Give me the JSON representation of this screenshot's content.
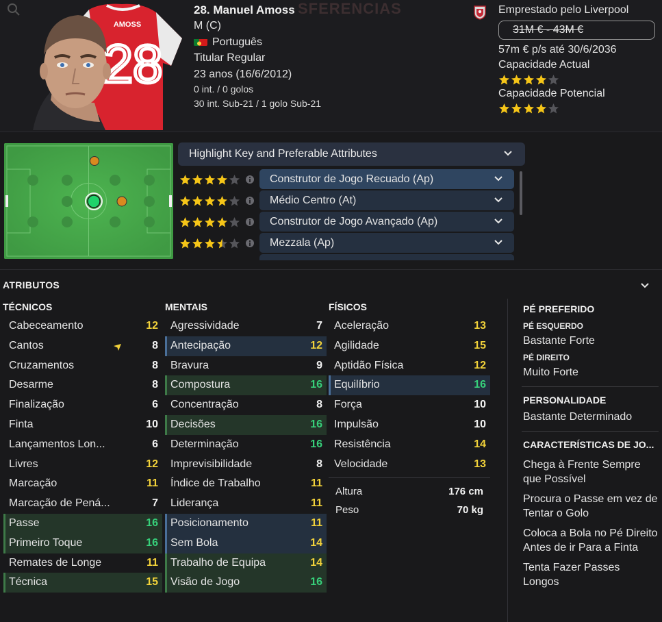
{
  "player": {
    "name": "28. Manuel Amoss",
    "position": "M (C)",
    "nationality": "Português",
    "status": "Titular Regular",
    "age": "23 anos (16/6/2012)",
    "caps": "0 int. / 0 golos",
    "u21_caps": "30 int. Sub-21 / 1 golo Sub-21",
    "shirt_name": "AMOSS",
    "shirt_number": "28"
  },
  "contract": {
    "loan": "Emprestado pelo Liverpool",
    "value_range": "31M € - 43M €",
    "wage": "57m € p/s até 30/6/2036",
    "current_ability_label": "Capacidade Actual",
    "current_ability_stars": 4,
    "potential_ability_label": "Capacidade Potencial",
    "potential_ability_stars": 4
  },
  "roles": {
    "header": "Highlight Key and Preferable Attributes",
    "items": [
      {
        "label": "Construtor de Jogo Recuado (Ap)",
        "stars": 4,
        "selected": true
      },
      {
        "label": "Médio Centro (At)",
        "stars": 4,
        "selected": false
      },
      {
        "label": "Construtor de Jogo Avançado (Ap)",
        "stars": 4,
        "selected": false
      },
      {
        "label": "Mezzala (Ap)",
        "stars": 3.5,
        "selected": false
      }
    ]
  },
  "attributes": {
    "title": "ATRIBUTOS",
    "technical": {
      "title": "TÉCNICOS",
      "items": [
        {
          "label": "Cabeceamento",
          "value": "12",
          "color": "yellow",
          "hl": ""
        },
        {
          "label": "Cantos",
          "value": "8",
          "color": "white",
          "hl": ""
        },
        {
          "label": "Cruzamentos",
          "value": "8",
          "color": "white",
          "hl": ""
        },
        {
          "label": "Desarme",
          "value": "8",
          "color": "white",
          "hl": ""
        },
        {
          "label": "Finalização",
          "value": "6",
          "color": "white",
          "hl": ""
        },
        {
          "label": "Finta",
          "value": "10",
          "color": "white",
          "hl": ""
        },
        {
          "label": "Lançamentos Lon...",
          "value": "6",
          "color": "white",
          "hl": ""
        },
        {
          "label": "Livres",
          "value": "12",
          "color": "yellow",
          "hl": ""
        },
        {
          "label": "Marcação",
          "value": "11",
          "color": "yellow",
          "hl": ""
        },
        {
          "label": "Marcação de Pená...",
          "value": "7",
          "color": "white",
          "hl": ""
        },
        {
          "label": "Passe",
          "value": "16",
          "color": "green",
          "hl": "g"
        },
        {
          "label": "Primeiro Toque",
          "value": "16",
          "color": "green",
          "hl": "g"
        },
        {
          "label": "Remates de Longe",
          "value": "11",
          "color": "yellow",
          "hl": ""
        },
        {
          "label": "Técnica",
          "value": "15",
          "color": "yellow",
          "hl": "g"
        }
      ]
    },
    "mental": {
      "title": "MENTAIS",
      "items": [
        {
          "label": "Agressividade",
          "value": "7",
          "color": "white",
          "hl": ""
        },
        {
          "label": "Antecipação",
          "value": "12",
          "color": "yellow",
          "hl": "b"
        },
        {
          "label": "Bravura",
          "value": "9",
          "color": "white",
          "hl": ""
        },
        {
          "label": "Compostura",
          "value": "16",
          "color": "green",
          "hl": "g"
        },
        {
          "label": "Concentração",
          "value": "8",
          "color": "white",
          "hl": ""
        },
        {
          "label": "Decisões",
          "value": "16",
          "color": "green",
          "hl": "g"
        },
        {
          "label": "Determinação",
          "value": "16",
          "color": "green",
          "hl": ""
        },
        {
          "label": "Imprevisibilidade",
          "value": "8",
          "color": "white",
          "hl": ""
        },
        {
          "label": "Índice de Trabalho",
          "value": "11",
          "color": "yellow",
          "hl": ""
        },
        {
          "label": "Liderança",
          "value": "11",
          "color": "yellow",
          "hl": ""
        },
        {
          "label": "Posicionamento",
          "value": "11",
          "color": "yellow",
          "hl": "b"
        },
        {
          "label": "Sem Bola",
          "value": "14",
          "color": "yellow",
          "hl": "b"
        },
        {
          "label": "Trabalho de Equipa",
          "value": "14",
          "color": "yellow",
          "hl": "g"
        },
        {
          "label": "Visão de Jogo",
          "value": "16",
          "color": "green",
          "hl": "g"
        }
      ]
    },
    "physical": {
      "title": "FÍSICOS",
      "items": [
        {
          "label": "Aceleração",
          "value": "13",
          "color": "yellow",
          "hl": ""
        },
        {
          "label": "Agilidade",
          "value": "15",
          "color": "yellow",
          "hl": ""
        },
        {
          "label": "Aptidão Física",
          "value": "12",
          "color": "yellow",
          "hl": ""
        },
        {
          "label": "Equilíbrio",
          "value": "16",
          "color": "green",
          "hl": "b"
        },
        {
          "label": "Força",
          "value": "10",
          "color": "white",
          "hl": ""
        },
        {
          "label": "Impulsão",
          "value": "10",
          "color": "white",
          "hl": ""
        },
        {
          "label": "Resistência",
          "value": "14",
          "color": "yellow",
          "hl": ""
        },
        {
          "label": "Velocidade",
          "value": "13",
          "color": "yellow",
          "hl": ""
        }
      ],
      "height_label": "Altura",
      "height_value": "176 cm",
      "weight_label": "Peso",
      "weight_value": "70 kg"
    }
  },
  "side": {
    "preferred_foot_title": "PÉ PREFERIDO",
    "left_foot_label": "PÉ ESQUERDO",
    "left_foot_value": "Bastante Forte",
    "right_foot_label": "PÉ DIREITO",
    "right_foot_value": "Muito Forte",
    "personality_title": "PERSONALIDADE",
    "personality_value": "Bastante Determinado",
    "traits_title": "CARACTERÍSTICAS DE JO...",
    "traits": [
      "Chega à Frente Sempre que Possível",
      "Procura o Passe em vez de Tentar o Golo",
      "Coloca a Bola no Pé Direito Antes de ir Para a Finta",
      "Tenta Fazer Passes Longos"
    ]
  },
  "colors": {
    "accent_yellow": "#f2d23a",
    "accent_green": "#37d07a",
    "pitch_green": "#45a148",
    "star_gold": "#f5c518"
  }
}
